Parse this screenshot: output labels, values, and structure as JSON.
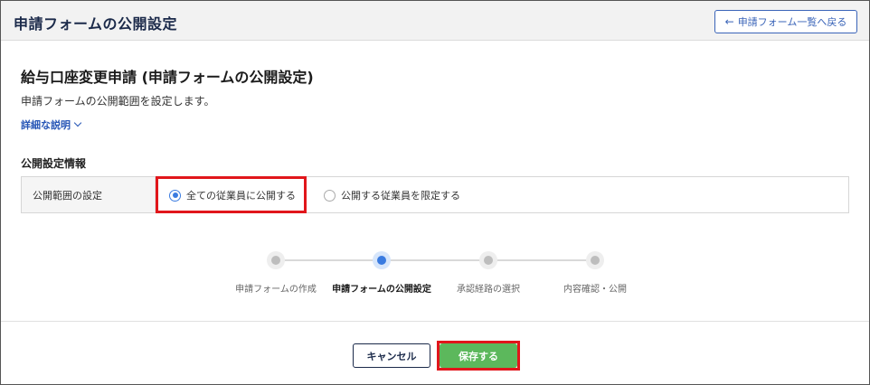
{
  "header": {
    "title": "申請フォームの公開設定",
    "back_button": "申請フォーム一覧へ戻る"
  },
  "page": {
    "title": "給与口座変更申請 (申請フォームの公開設定)",
    "description": "申請フォームの公開範囲を設定します。",
    "detail_link": "詳細な説明"
  },
  "section": {
    "title": "公開設定情報",
    "row_label": "公開範囲の設定",
    "options": [
      {
        "label": "全ての従業員に公開する",
        "checked": true
      },
      {
        "label": "公開する従業員を限定する",
        "checked": false
      }
    ]
  },
  "steps": [
    {
      "label": "申請フォームの作成",
      "active": false
    },
    {
      "label": "申請フォームの公開設定",
      "active": true
    },
    {
      "label": "承認経路の選択",
      "active": false
    },
    {
      "label": "内容確認・公開",
      "active": false
    }
  ],
  "footer": {
    "cancel_label": "キャンセル",
    "save_label": "保存する"
  },
  "colors": {
    "accent": "#3a7be0",
    "save": "#5cb85c",
    "highlight": "#e1161b",
    "header_bg": "#f2f2f2"
  }
}
